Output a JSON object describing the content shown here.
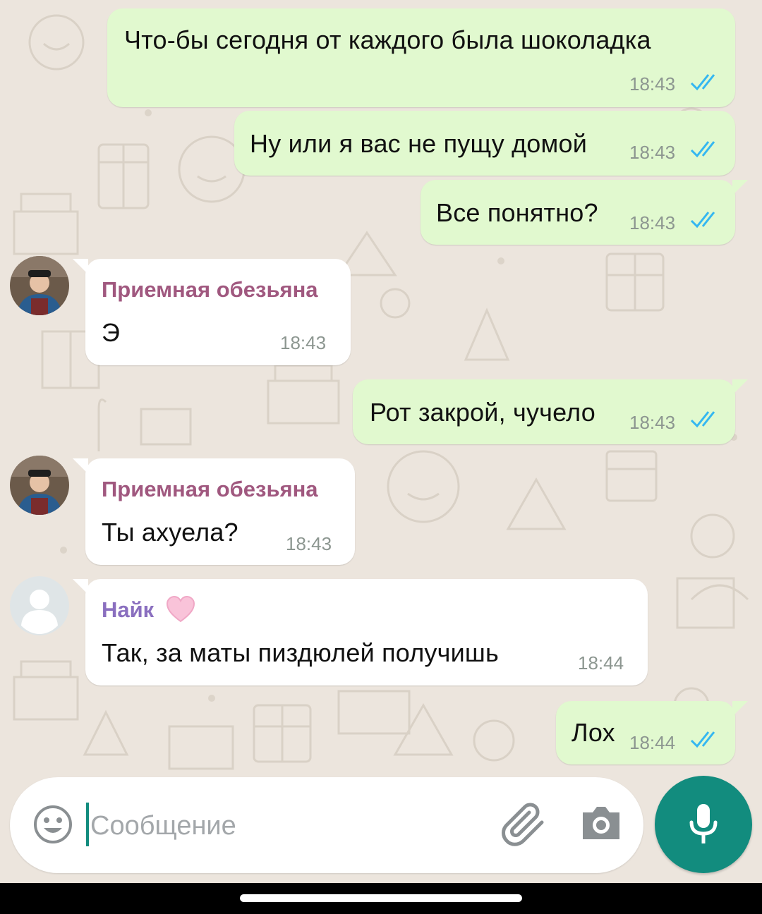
{
  "messages": [
    {
      "direction": "out",
      "text": "Что-бы сегодня от каждого была шоколадка",
      "time": "18:43",
      "status": "read"
    },
    {
      "direction": "out",
      "text": "Ну или я вас не пущу домой",
      "time": "18:43",
      "status": "read"
    },
    {
      "direction": "out",
      "text": "Все понятно?",
      "time": "18:43",
      "status": "read"
    },
    {
      "direction": "in",
      "sender": "Приемная обезьяна",
      "sender_color": "#a0587f",
      "text": "Э",
      "time": "18:43"
    },
    {
      "direction": "out",
      "text": "Рот закрой, чучело",
      "time": "18:43",
      "status": "read"
    },
    {
      "direction": "in",
      "sender": "Приемная обезьяна",
      "sender_color": "#a0587f",
      "text": "Ты ахуела?",
      "time": "18:43"
    },
    {
      "direction": "in",
      "sender": "Найк",
      "sender_emoji": "heart-icon",
      "sender_color": "#8a6fbf",
      "text": "Так, за маты пиздюлей получишь",
      "time": "18:44"
    },
    {
      "direction": "out",
      "text": "Лох",
      "time": "18:44",
      "status": "read"
    }
  ],
  "composer": {
    "placeholder": "Сообщение",
    "icons": [
      "emoji-icon",
      "attach-icon",
      "camera-icon",
      "mic-icon"
    ]
  },
  "colors": {
    "outgoing_bubble": "#e1f9cf",
    "incoming_bubble": "#ffffff",
    "read_ticks": "#34b7f1",
    "accent": "#128c7e",
    "wallpaper": "#ece5dd"
  }
}
